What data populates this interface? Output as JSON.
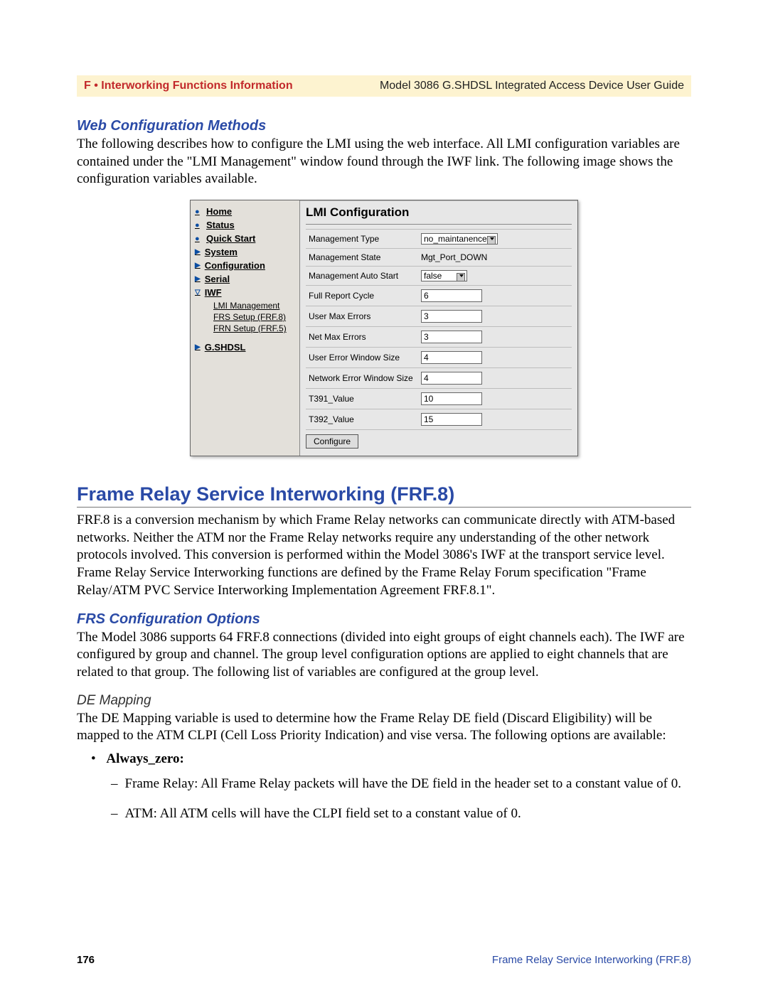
{
  "header": {
    "left": "F • Interworking Functions Information",
    "right": "Model 3086 G.SHDSL Integrated Access Device User Guide"
  },
  "section1": {
    "title": "Web Configuration Methods",
    "body": "The following describes how to configure the LMI using the web interface. All LMI configuration variables are contained under the \"LMI Management\" window found through the IWF link. The following image shows the configuration variables available."
  },
  "screenshot": {
    "nav": {
      "home": "Home",
      "status": "Status",
      "quick": "Quick Start",
      "system": "System",
      "config": "Configuration",
      "serial": "Serial",
      "iwf": "IWF",
      "sub_lmi": "LMI Management",
      "sub_frs": "FRS Setup (FRF.8)",
      "sub_frn": "FRN Setup (FRF.5)",
      "gshdsl": "G.SHDSL"
    },
    "panel": {
      "title": "LMI Configuration",
      "rows": {
        "mgmt_type_label": "Management Type",
        "mgmt_type_value": "no_maintanence",
        "mgmt_state_label": "Management State",
        "mgmt_state_value": "Mgt_Port_DOWN",
        "auto_start_label": "Management Auto Start",
        "auto_start_value": "false",
        "full_report_label": "Full Report Cycle",
        "full_report_value": "6",
        "user_max_err_label": "User Max Errors",
        "user_max_err_value": "3",
        "net_max_err_label": "Net Max Errors",
        "net_max_err_value": "3",
        "user_err_win_label": "User Error Window Size",
        "user_err_win_value": "4",
        "net_err_win_label": "Network Error Window Size",
        "net_err_win_value": "4",
        "t391_label": "T391_Value",
        "t391_value": "10",
        "t392_label": "T392_Value",
        "t392_value": "15"
      },
      "button": "Configure"
    }
  },
  "section2": {
    "title": "Frame Relay Service Interworking (FRF.8)",
    "body": "FRF.8 is a conversion mechanism by which Frame Relay networks can communicate directly with ATM-based networks. Neither the ATM nor the Frame Relay networks require any understanding of the other network protocols involved. This conversion is performed within the Model 3086's IWF at the transport service level. Frame Relay Service Interworking functions are defined by the Frame Relay Forum specification \"Frame Relay/ATM PVC Service Interworking Implementation Agreement FRF.8.1\"."
  },
  "section3": {
    "title": "FRS Configuration Options",
    "body": "The Model 3086 supports 64 FRF.8 connections (divided into eight groups of eight channels each). The IWF are configured by group and channel. The group level configuration options are applied to eight channels that are related to that group. The following list of variables are configured at the group level."
  },
  "section4": {
    "title": "DE Mapping",
    "body": "The DE Mapping variable is used to determine how the Frame Relay DE field (Discard Eligibility) will be mapped to the ATM CLPI (Cell Loss Priority Indication) and vise versa. The following options are available:",
    "bullet_label": "Always_zero:",
    "dash1": "Frame Relay: All Frame Relay packets will have the DE field in the header set to a constant value of 0.",
    "dash2": "ATM: All ATM cells will have the CLPI field set to a constant value of 0."
  },
  "footer": {
    "page": "176",
    "title": "Frame Relay Service Interworking (FRF.8)"
  }
}
